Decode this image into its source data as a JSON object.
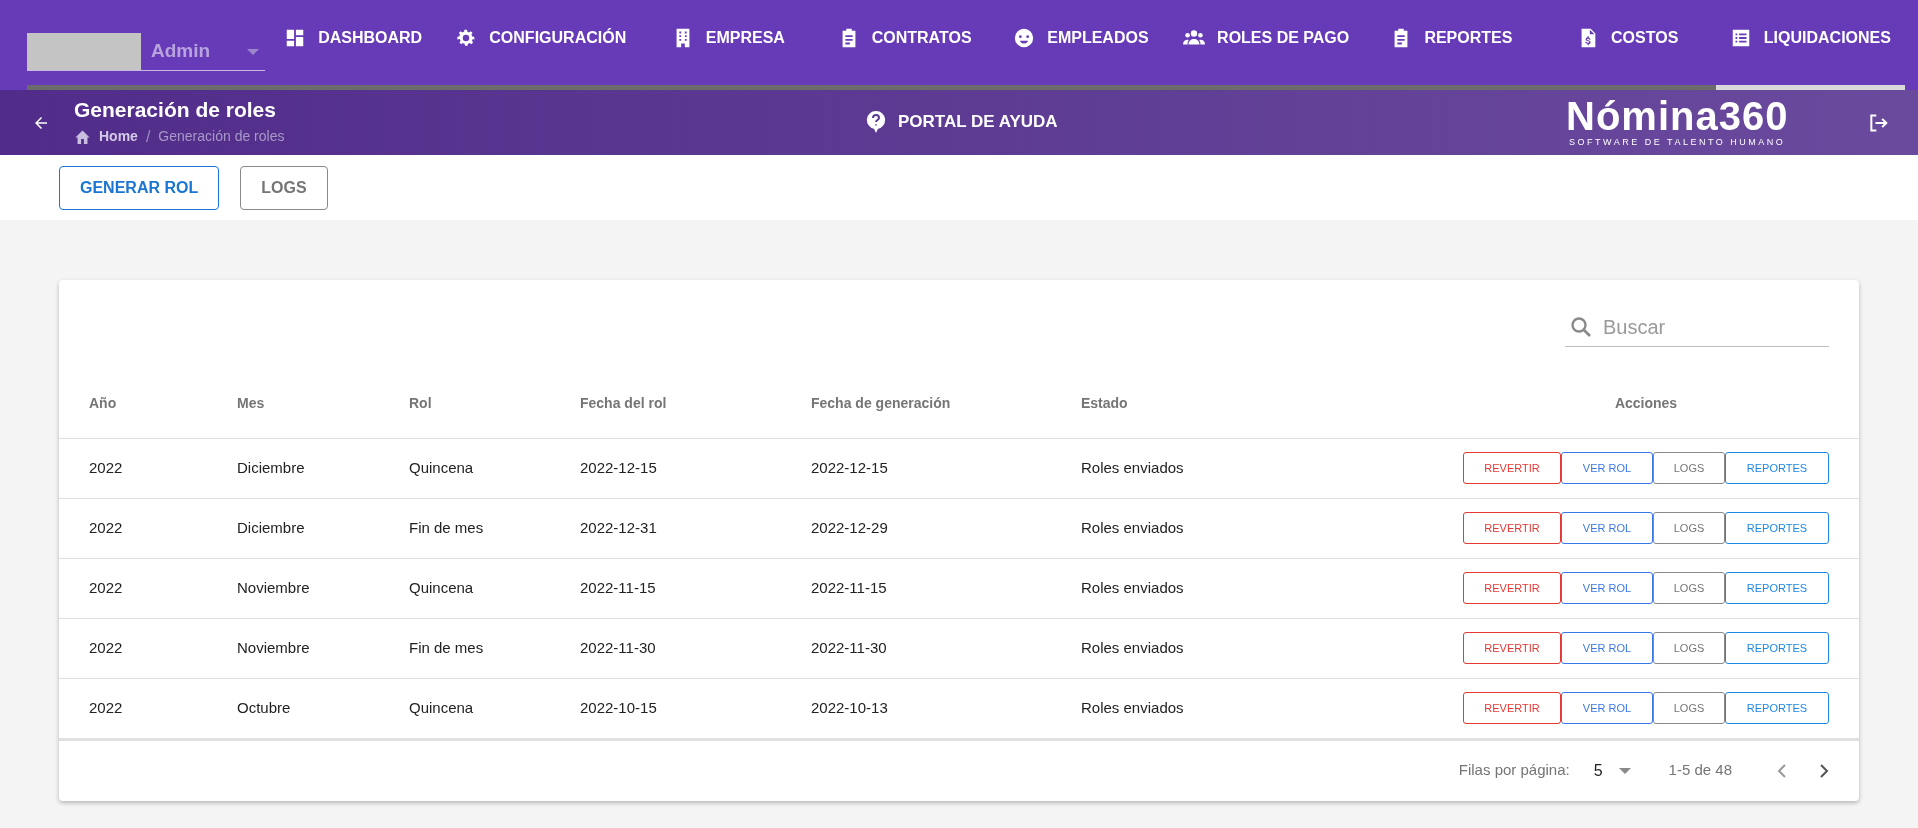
{
  "account": {
    "role": "Admin"
  },
  "nav_tabs": [
    {
      "label": "DASHBOARD",
      "kind": "dashboard",
      "selected": false
    },
    {
      "label": "CONFIGURACIÓN",
      "kind": "gear",
      "selected": false
    },
    {
      "label": "EMPRESA",
      "kind": "building",
      "selected": false
    },
    {
      "label": "CONTRATOS",
      "kind": "clipboard",
      "selected": false
    },
    {
      "label": "EMPLEADOS",
      "kind": "face",
      "selected": false
    },
    {
      "label": "ROLES DE PAGO",
      "kind": "people",
      "selected": false
    },
    {
      "label": "REPORTES",
      "kind": "clipboard",
      "selected": false
    },
    {
      "label": "COSTOS",
      "kind": "invoice",
      "selected": false
    },
    {
      "label": "LIQUIDACIONES",
      "kind": "list",
      "selected": true
    }
  ],
  "page_header": {
    "title": "Generación de roles",
    "breadcrumb": {
      "home": "Home",
      "separator": "/",
      "current": "Generación de roles"
    },
    "help_link": "PORTAL DE AYUDA",
    "logo": {
      "name": "Nómina360",
      "tagline": "SOFTWARE DE TALENTO HUMANO"
    }
  },
  "toolbar": [
    {
      "label": "GENERAR ROL",
      "kind": "primary"
    },
    {
      "label": "LOGS",
      "kind": "secondary"
    }
  ],
  "table": {
    "search": {
      "placeholder": "Buscar"
    },
    "columns": [
      "Año",
      "Mes",
      "Rol",
      "Fecha del rol",
      "Fecha de generación",
      "Estado",
      "Acciones"
    ],
    "rows": [
      {
        "cells": [
          "2022",
          "Diciembre",
          "Quincena",
          "2022-12-15",
          "2022-12-15",
          "Roles enviados"
        ],
        "actions": [
          {
            "label": "REVERTIR",
            "kind": "danger"
          },
          {
            "label": "VER ROL",
            "kind": "primary"
          },
          {
            "label": "LOGS",
            "kind": "secondary"
          },
          {
            "label": "REPORTES",
            "kind": "info"
          }
        ]
      },
      {
        "cells": [
          "2022",
          "Diciembre",
          "Fin de mes",
          "2022-12-31",
          "2022-12-29",
          "Roles enviados"
        ],
        "actions": [
          {
            "label": "REVERTIR",
            "kind": "danger"
          },
          {
            "label": "VER ROL",
            "kind": "primary"
          },
          {
            "label": "LOGS",
            "kind": "secondary"
          },
          {
            "label": "REPORTES",
            "kind": "info"
          }
        ]
      },
      {
        "cells": [
          "2022",
          "Noviembre",
          "Quincena",
          "2022-11-15",
          "2022-11-15",
          "Roles enviados"
        ],
        "actions": [
          {
            "label": "REVERTIR",
            "kind": "danger"
          },
          {
            "label": "VER ROL",
            "kind": "primary"
          },
          {
            "label": "LOGS",
            "kind": "secondary"
          },
          {
            "label": "REPORTES",
            "kind": "info"
          }
        ]
      },
      {
        "cells": [
          "2022",
          "Noviembre",
          "Fin de mes",
          "2022-11-30",
          "2022-11-30",
          "Roles enviados"
        ],
        "actions": [
          {
            "label": "REVERTIR",
            "kind": "danger"
          },
          {
            "label": "VER ROL",
            "kind": "primary"
          },
          {
            "label": "LOGS",
            "kind": "secondary"
          },
          {
            "label": "REPORTES",
            "kind": "info"
          }
        ]
      },
      {
        "cells": [
          "2022",
          "Octubre",
          "Quincena",
          "2022-10-15",
          "2022-10-13",
          "Roles enviados"
        ],
        "actions": [
          {
            "label": "REVERTIR",
            "kind": "danger"
          },
          {
            "label": "VER ROL",
            "kind": "primary"
          },
          {
            "label": "LOGS",
            "kind": "secondary"
          },
          {
            "label": "REPORTES",
            "kind": "info"
          }
        ]
      }
    ],
    "pagination": {
      "rows_per_page_label": "Filas por página:",
      "rows_per_page": "5",
      "range": "1-5 de 48"
    }
  }
}
